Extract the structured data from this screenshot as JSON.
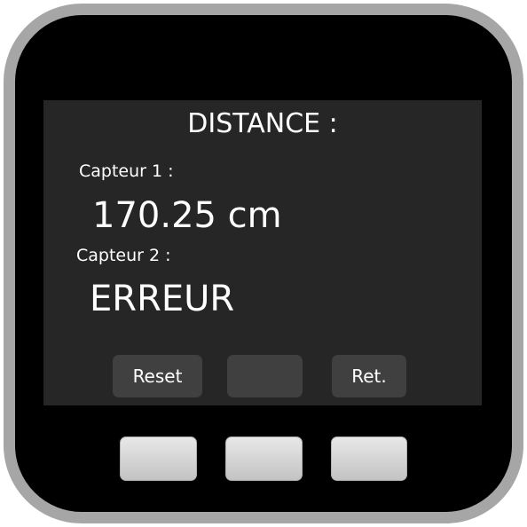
{
  "screen": {
    "title": "DISTANCE :",
    "sensors": [
      {
        "label": "Capteur 1 :",
        "value": "170.25 cm"
      },
      {
        "label": "Capteur 2 :",
        "value": "ERREUR"
      }
    ],
    "softkeys": [
      {
        "label": "Reset"
      },
      {
        "label": ""
      },
      {
        "label": "Ret."
      }
    ]
  },
  "colors": {
    "bezel": "#a6a6a6",
    "body": "#000000",
    "screen": "#262626",
    "softkey": "#404040",
    "text": "#ffffff"
  }
}
